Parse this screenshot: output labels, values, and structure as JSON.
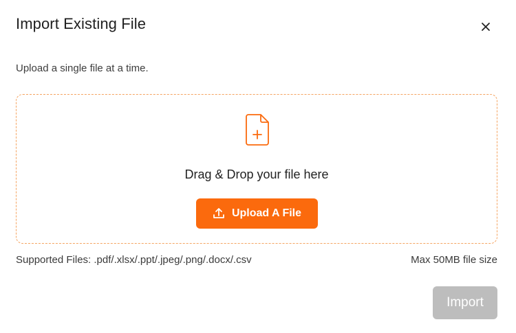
{
  "dialog": {
    "title": "Import Existing File",
    "close_label": "×",
    "subtitle": "Upload a single file at a time.",
    "dropzone": {
      "text": "Drag & Drop your file here",
      "icon": "file-plus-icon",
      "upload_button_label": "Upload A File",
      "upload_icon": "upload-icon"
    },
    "supported_files": "Supported Files: .pdf/.xlsx/.ppt/.jpeg/.png/.docx/.csv",
    "max_size": "Max 50MB file size",
    "import_button_label": "Import"
  },
  "colors": {
    "accent": "#fb6a0d",
    "dropzone_border": "#f5a35f",
    "disabled_button": "#bdbdbd"
  }
}
